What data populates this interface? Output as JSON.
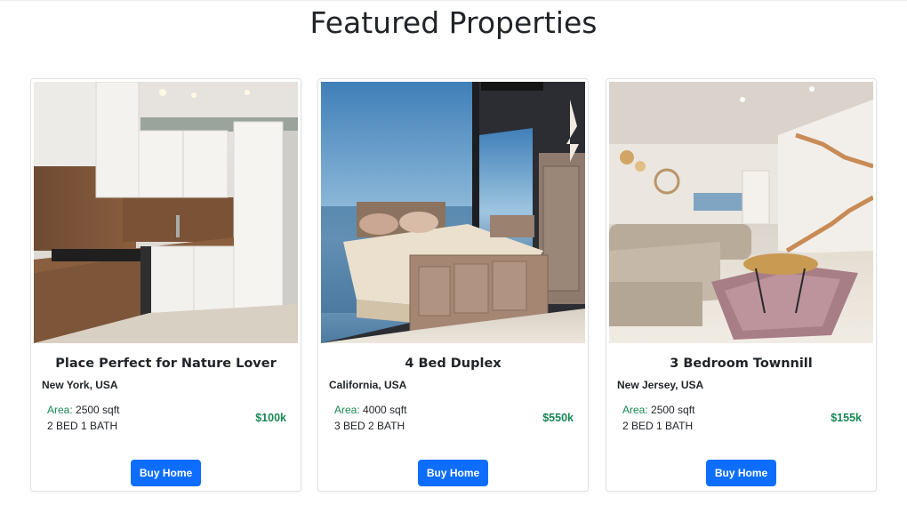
{
  "page": {
    "title": "Featured Properties"
  },
  "properties": [
    {
      "title": "Place Perfect for Nature Lover",
      "location": "New York, USA",
      "area_label": "Area:",
      "area_value": "2500 sqft",
      "beds": "2 BED 1 BATH",
      "price": "$100k",
      "button": "Buy Home"
    },
    {
      "title": "4 Bed Duplex",
      "location": "California, USA",
      "area_label": "Area:",
      "area_value": "4000 sqft",
      "beds": "3 BED 2 BATH",
      "price": "$550k",
      "button": "Buy Home"
    },
    {
      "title": "3 Bedroom Townnill",
      "location": "New Jersey, USA",
      "area_label": "Area:",
      "area_value": "2500 sqft",
      "beds": "2 BED 1 BATH",
      "price": "$155k",
      "button": "Buy Home"
    }
  ],
  "colors": {
    "accent": "#0d6efd",
    "price": "#198754",
    "area_label": "#198754"
  }
}
